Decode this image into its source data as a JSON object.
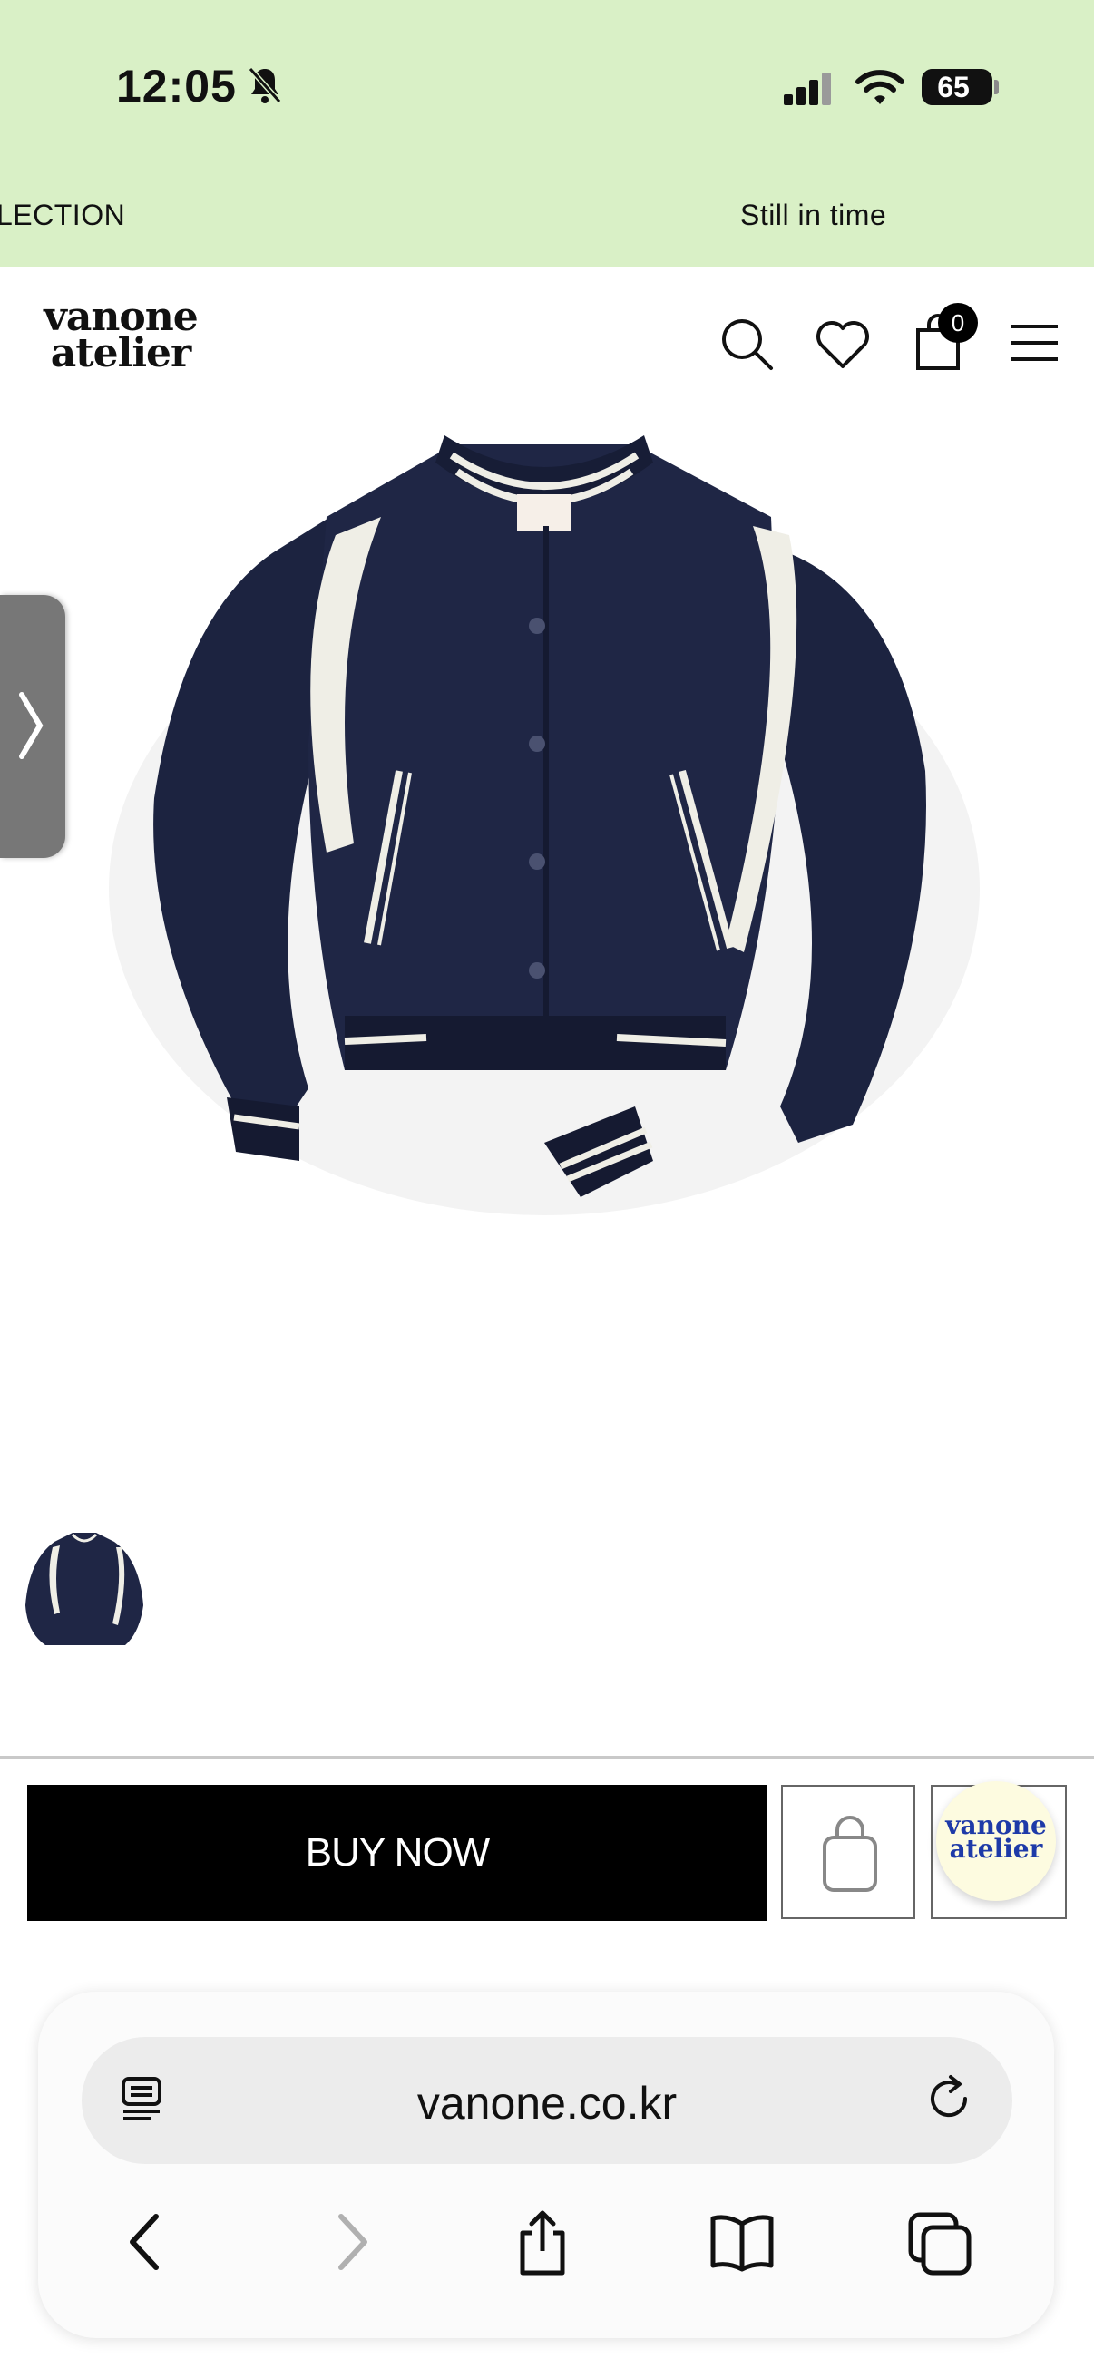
{
  "status_bar": {
    "time": "12:05",
    "battery": "65"
  },
  "marquee": {
    "left_text": "LECTION",
    "right_text": "Still in time"
  },
  "header": {
    "logo_line1": "vanone",
    "logo_line2": "atelier",
    "cart_count": "0"
  },
  "actions": {
    "buy_now_label": "BUY NOW",
    "chat_logo_line1": "vanone",
    "chat_logo_line2": "atelier"
  },
  "browser": {
    "url": "vanone.co.kr"
  },
  "colors": {
    "topband": "#d9f0c6",
    "buy_now_bg": "#000000",
    "chat_bubble": "#fdfbe0",
    "chat_logo": "#1e3aa8"
  },
  "icons": [
    "bell-slash-icon",
    "signal-icon",
    "wifi-icon",
    "battery-icon",
    "search-icon",
    "heart-icon",
    "bag-icon",
    "hamburger-icon",
    "chevron-right-icon",
    "bag-outline-icon",
    "reader-icon",
    "reload-icon",
    "back-icon",
    "forward-icon",
    "share-icon",
    "bookmarks-icon",
    "tabs-icon"
  ]
}
